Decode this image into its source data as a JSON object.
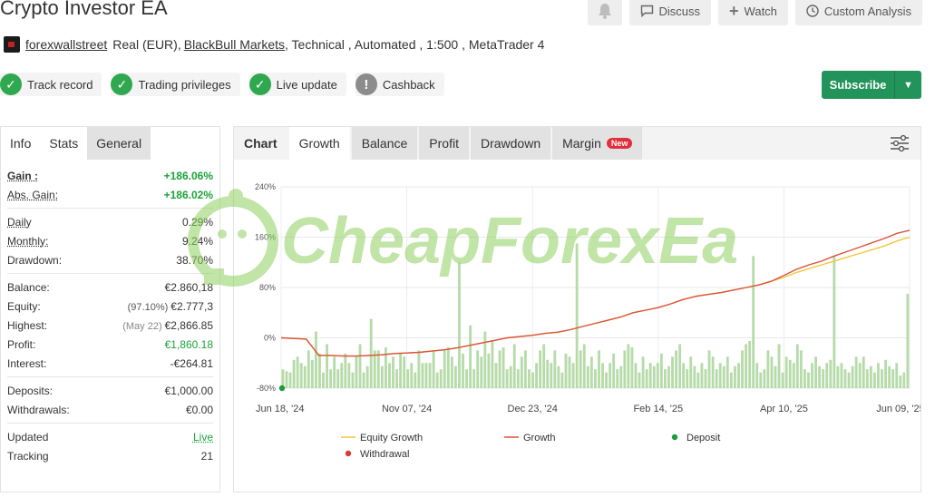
{
  "header": {
    "title": "Crypto Investor EA",
    "actions": {
      "discuss": "Discuss",
      "watch": "Watch",
      "custom_analysis": "Custom Analysis"
    }
  },
  "meta": {
    "user": "forexwallstreet",
    "account": "Real (EUR),",
    "broker": "BlackBull Markets",
    "details": ", Technical , Automated , 1:500 , MetaTrader 4"
  },
  "badges": {
    "track_record": "Track record",
    "trading_privileges": "Trading privileges",
    "live_update": "Live update",
    "cashback": "Cashback"
  },
  "subscribe": "Subscribe",
  "left_panel": {
    "tabs": [
      "Info",
      "Stats",
      "General"
    ],
    "gain_label": "Gain :",
    "gain_value": "+186.06%",
    "abs_gain_label": "Abs. Gain:",
    "abs_gain_value": "+186.02%",
    "daily_label": "Daily",
    "daily_value": "0.29%",
    "monthly_label": "Monthly:",
    "monthly_value": "9.24%",
    "drawdown_label": "Drawdown:",
    "drawdown_value": "38.70%",
    "balance_label": "Balance:",
    "balance_value": "€2.860,18",
    "equity_label": "Equity:",
    "equity_sub": "(97.10%)",
    "equity_value": "€2.777,3",
    "highest_label": "Highest:",
    "highest_sub": "(May 22)",
    "highest_value": "€2,866.85",
    "profit_label": "Profit:",
    "profit_value": "€1,860.18",
    "interest_label": "Interest:",
    "interest_value": "-€264.81",
    "deposits_label": "Deposits:",
    "deposits_value": "€1,000.00",
    "withdrawals_label": "Withdrawals:",
    "withdrawals_value": "€0.00",
    "updated_label": "Updated",
    "updated_value": "Live",
    "tracking_label": "Tracking",
    "tracking_value": "21"
  },
  "chart_tabs": {
    "chart": "Chart",
    "growth": "Growth",
    "balance": "Balance",
    "profit": "Profit",
    "drawdown": "Drawdown",
    "margin": "Margin",
    "new_tag": "New"
  },
  "watermark": "CheapForexEa",
  "chart_data": {
    "type": "line",
    "y_ticks": [
      "240%",
      "160%",
      "80%",
      "0%",
      "-80%"
    ],
    "ylim": [
      -80,
      240
    ],
    "x_ticks": [
      "Jun 18, '24",
      "Nov 07, '24",
      "Dec 23, '24",
      "Feb 14, '25",
      "Apr 10, '25",
      "Jun 09, '25"
    ],
    "legend": {
      "equity": "Equity Growth",
      "growth": "Growth",
      "deposit": "Deposit",
      "withdrawal": "Withdrawal"
    },
    "colors": {
      "equity": "#f2c640",
      "growth": "#d9533b",
      "deposit": "#1f9a3d",
      "withdrawal": "#d63a3a",
      "bars": "#b6dba9"
    },
    "growth": [
      0,
      -1,
      -2,
      -28,
      -28,
      -29,
      -29,
      -28,
      -27,
      -25,
      -24,
      -23,
      -21,
      -19,
      -16,
      -12,
      -8,
      -4,
      0,
      2,
      4,
      7,
      9,
      13,
      18,
      23,
      28,
      33,
      40,
      44,
      48,
      54,
      61,
      66,
      69,
      72,
      76,
      80,
      84,
      90,
      99,
      109,
      116,
      122,
      130,
      137,
      144,
      151,
      158,
      166,
      171
    ],
    "equity_growth": [
      0,
      -1,
      -2,
      -28,
      -28,
      -29,
      -29,
      -28,
      -27,
      -25,
      -24,
      -23,
      -21,
      -19,
      -16,
      -12,
      -8,
      -4,
      0,
      2,
      4,
      7,
      9,
      13,
      18,
      23,
      28,
      33,
      40,
      44,
      48,
      54,
      61,
      66,
      69,
      72,
      76,
      80,
      84,
      90,
      96,
      104,
      110,
      116,
      122,
      128,
      134,
      140,
      146,
      154,
      160
    ],
    "bars": [
      -50,
      -53,
      -55,
      -35,
      -30,
      -40,
      -45,
      -20,
      -35,
      10,
      -25,
      -55,
      -10,
      -50,
      -30,
      -50,
      -40,
      -25,
      -40,
      -55,
      -30,
      -10,
      -55,
      -45,
      30,
      -20,
      -20,
      -45,
      -15,
      -40,
      -30,
      -50,
      -25,
      -30,
      -50,
      -40,
      -55,
      -20,
      -40,
      -40,
      -40,
      -20,
      -55,
      -50,
      -20,
      -15,
      -30,
      -45,
      -10,
      -25,
      -50,
      20,
      -50,
      -20,
      -30,
      10,
      -25,
      -5,
      -40,
      -20,
      -15,
      -50,
      -45,
      -10,
      -50,
      -30,
      -20,
      -50,
      -55,
      -40,
      -20,
      -10,
      -35,
      -40,
      -20,
      -45,
      -55,
      -25,
      -30,
      -40,
      -50,
      -20,
      -10,
      -45,
      -30,
      -50,
      -20,
      -40,
      -55,
      -40,
      -25,
      -50,
      -45,
      -20,
      -10,
      -15,
      -40,
      -55,
      -30,
      -50,
      -40,
      -45,
      -40,
      -25,
      -50,
      -45,
      -30,
      -20,
      -10,
      -40,
      -50,
      -30,
      -45,
      -55,
      -40,
      -50,
      -20,
      -30,
      -50,
      -40,
      -45,
      -30,
      -55,
      -45,
      -40,
      -20,
      -10,
      -5,
      -20,
      -40,
      -55,
      -50,
      -20,
      -30,
      -45,
      -10,
      -55,
      -30,
      -35,
      -40,
      -10,
      -20,
      -50,
      -55,
      -40,
      -30,
      -45,
      -50,
      -40,
      -35,
      -60,
      -45,
      -40,
      -50,
      -55,
      -45,
      -30,
      -40,
      -30,
      -50,
      -45,
      -55,
      -40,
      -50,
      -35,
      -45,
      -50,
      -40,
      -60,
      -55,
      70
    ],
    "bar_spikes": {
      "index": [
        48,
        80,
        128,
        150
      ],
      "values": [
        120,
        150,
        130,
        130
      ]
    }
  }
}
